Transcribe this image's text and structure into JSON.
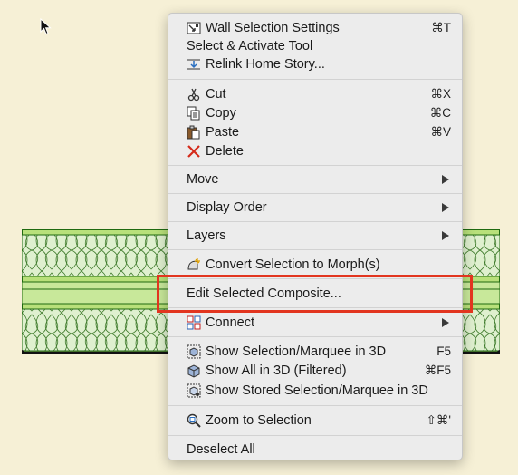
{
  "menu": {
    "items": [
      {
        "id": "wall-selection-settings",
        "label": "Wall Selection Settings",
        "shortcut": "⌘T",
        "icon": "wall-settings-icon"
      },
      {
        "id": "select-activate-tool",
        "label": "Select & Activate Tool",
        "shortcut": "",
        "icon": ""
      },
      {
        "id": "relink-home-story",
        "label": "Relink Home Story...",
        "shortcut": "",
        "icon": "relink-story-icon"
      },
      {
        "id": "cut",
        "label": "Cut",
        "shortcut": "⌘X",
        "icon": "scissors-icon"
      },
      {
        "id": "copy",
        "label": "Copy",
        "shortcut": "⌘C",
        "icon": "copy-icon"
      },
      {
        "id": "paste",
        "label": "Paste",
        "shortcut": "⌘V",
        "icon": "paste-icon"
      },
      {
        "id": "delete",
        "label": "Delete",
        "shortcut": "",
        "icon": "delete-x-icon"
      },
      {
        "id": "move",
        "label": "Move",
        "submenu": true
      },
      {
        "id": "display-order",
        "label": "Display Order",
        "submenu": true
      },
      {
        "id": "layers",
        "label": "Layers",
        "submenu": true
      },
      {
        "id": "convert-to-morph",
        "label": "Convert Selection to Morph(s)",
        "shortcut": "",
        "icon": "morph-icon"
      },
      {
        "id": "edit-selected-composite",
        "label": "Edit Selected Composite...",
        "shortcut": "",
        "icon": ""
      },
      {
        "id": "connect",
        "label": "Connect",
        "submenu": true,
        "icon": "connect-icon"
      },
      {
        "id": "show-selection-3d",
        "label": "Show Selection/Marquee in 3D",
        "shortcut": "F5",
        "icon": "cube-selection-icon"
      },
      {
        "id": "show-all-3d",
        "label": "Show All in 3D (Filtered)",
        "shortcut": "⌘F5",
        "icon": "cube-icon"
      },
      {
        "id": "show-stored-3d",
        "label": "Show Stored Selection/Marquee in 3D",
        "shortcut": "",
        "icon": "cube-stored-icon"
      },
      {
        "id": "zoom-to-selection",
        "label": "Zoom to Selection",
        "shortcut": "⇧⌘'",
        "icon": "zoom-icon"
      },
      {
        "id": "deselect-all",
        "label": "Deselect All",
        "shortcut": "",
        "icon": ""
      }
    ]
  },
  "colors": {
    "highlight": "#e2351f",
    "wall_fill": "#b8e07a",
    "wall_stroke": "#1f6a10",
    "insulation": "#e8f4dc"
  }
}
